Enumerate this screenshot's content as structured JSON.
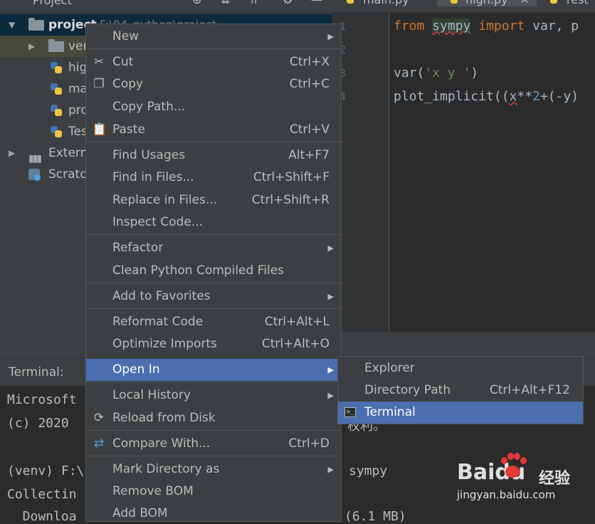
{
  "project_pane": {
    "title": "Project",
    "tree": [
      {
        "label": "project",
        "path": "F:\\04_python\\project"
      },
      {
        "label": "venv"
      },
      {
        "label": "high.py"
      },
      {
        "label": "main.py"
      },
      {
        "label": "project.py"
      },
      {
        "label": "Test.py"
      },
      {
        "label": "External Libraries"
      },
      {
        "label": "Scratches and Consoles"
      }
    ]
  },
  "editor": {
    "tabs": [
      {
        "label": "main.py"
      },
      {
        "label": "high.py"
      },
      {
        "label": "rest"
      }
    ],
    "line_numbers": [
      "1",
      "2",
      "3",
      "4"
    ],
    "code": {
      "l1_from": "from",
      "l1_module": "sympy",
      "l1_import": "import",
      "l1_rest": "var, p",
      "l3_call": "var(",
      "l3_str": "'x y '",
      "l3_close": ")",
      "l4_a": "plot_implicit((",
      "l4_x": "x",
      "l4_b": "**",
      "l4_n": "2",
      "l4_c": "+(-y)"
    }
  },
  "terminal": {
    "title": "Terminal:",
    "lines": [
      "Microsoft",
      "(c) 2020",
      "",
      "(venv) F:\\",
      "Collectin",
      "  Downloa"
    ],
    "overflow": {
      "rights": "权利。",
      "sympy": "sympy",
      "size": "(6.1 MB)"
    }
  },
  "context_menu": {
    "items": [
      {
        "label": "New",
        "shortcut": "",
        "submenu": true
      },
      {
        "label": "Cut",
        "shortcut": "Ctrl+X",
        "icon": "scissors-icon"
      },
      {
        "label": "Copy",
        "shortcut": "Ctrl+C",
        "icon": "copy-icon"
      },
      {
        "label": "Copy Path...",
        "shortcut": ""
      },
      {
        "label": "Paste",
        "shortcut": "Ctrl+V",
        "icon": "clipboard-icon"
      },
      {
        "label": "Find Usages",
        "shortcut": "Alt+F7"
      },
      {
        "label": "Find in Files...",
        "shortcut": "Ctrl+Shift+F"
      },
      {
        "label": "Replace in Files...",
        "shortcut": "Ctrl+Shift+R"
      },
      {
        "label": "Inspect Code...",
        "shortcut": ""
      },
      {
        "label": "Refactor",
        "shortcut": "",
        "submenu": true
      },
      {
        "label": "Clean Python Compiled Files",
        "shortcut": ""
      },
      {
        "label": "Add to Favorites",
        "shortcut": "",
        "submenu": true
      },
      {
        "label": "Reformat Code",
        "shortcut": "Ctrl+Alt+L"
      },
      {
        "label": "Optimize Imports",
        "shortcut": "Ctrl+Alt+O"
      },
      {
        "label": "Open In",
        "shortcut": "",
        "submenu": true,
        "active": true
      },
      {
        "label": "Local History",
        "shortcut": "",
        "submenu": true
      },
      {
        "label": "Reload from Disk",
        "shortcut": "",
        "icon": "reload-icon"
      },
      {
        "label": "Compare With...",
        "shortcut": "Ctrl+D",
        "icon": "compare-icon"
      },
      {
        "label": "Mark Directory as",
        "shortcut": "",
        "submenu": true
      },
      {
        "label": "Remove BOM",
        "shortcut": ""
      },
      {
        "label": "Add BOM",
        "shortcut": ""
      }
    ]
  },
  "submenu": {
    "items": [
      {
        "label": "Explorer",
        "shortcut": ""
      },
      {
        "label": "Directory Path",
        "shortcut": "Ctrl+Alt+F12"
      },
      {
        "label": "Terminal",
        "shortcut": "",
        "active": true
      }
    ]
  },
  "watermark": {
    "brand": "Baidu",
    "brand_cn": "经验",
    "url": "jingyan.baidu.com"
  },
  "colors": {
    "menu_highlight": "#4b6eaf",
    "panel": "#3c3f41",
    "editor_bg": "#2b2b2b",
    "keyword": "#cc7832",
    "string": "#6a8759",
    "number": "#6897bb",
    "baidu_red": "#e53935"
  }
}
